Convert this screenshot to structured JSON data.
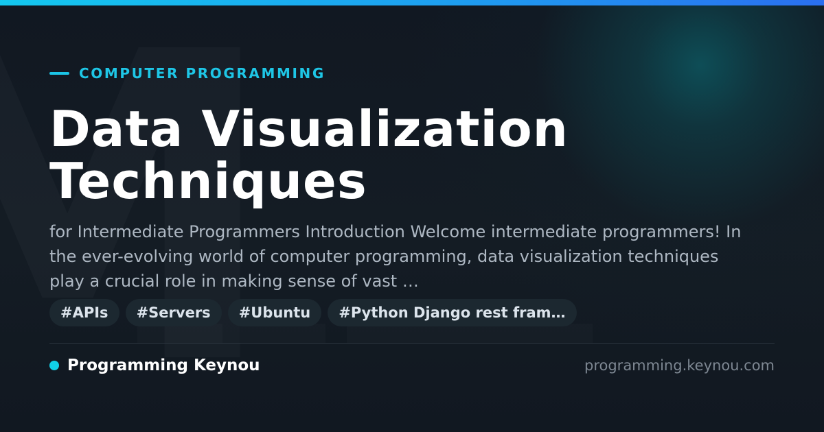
{
  "colors": {
    "accent": "#1EC6E6",
    "background": "#121820",
    "top_bar_start": "#14C8EF",
    "top_bar_end": "#2A6FF0",
    "title": "#FFFFFF",
    "description": "#AEB8C3",
    "tag_background": "#1C2830"
  },
  "icons": {
    "category_marker": "accent-dash",
    "brand_marker": "status-dot"
  },
  "header": {
    "category": "COMPUTER PROGRAMMING"
  },
  "article": {
    "title": "Data Visualization Techniques",
    "description": "for Intermediate Programmers Introduction Welcome intermediate programmers! In the ever-evolving world of computer programming, data visualization techniques play a crucial role in making sense of vast …",
    "tags": [
      "#APIs",
      "#Servers",
      "#Ubuntu",
      "#Python Django rest fram…"
    ]
  },
  "footer": {
    "brand": "Programming Keynou",
    "url": "programming.keynou.com"
  }
}
